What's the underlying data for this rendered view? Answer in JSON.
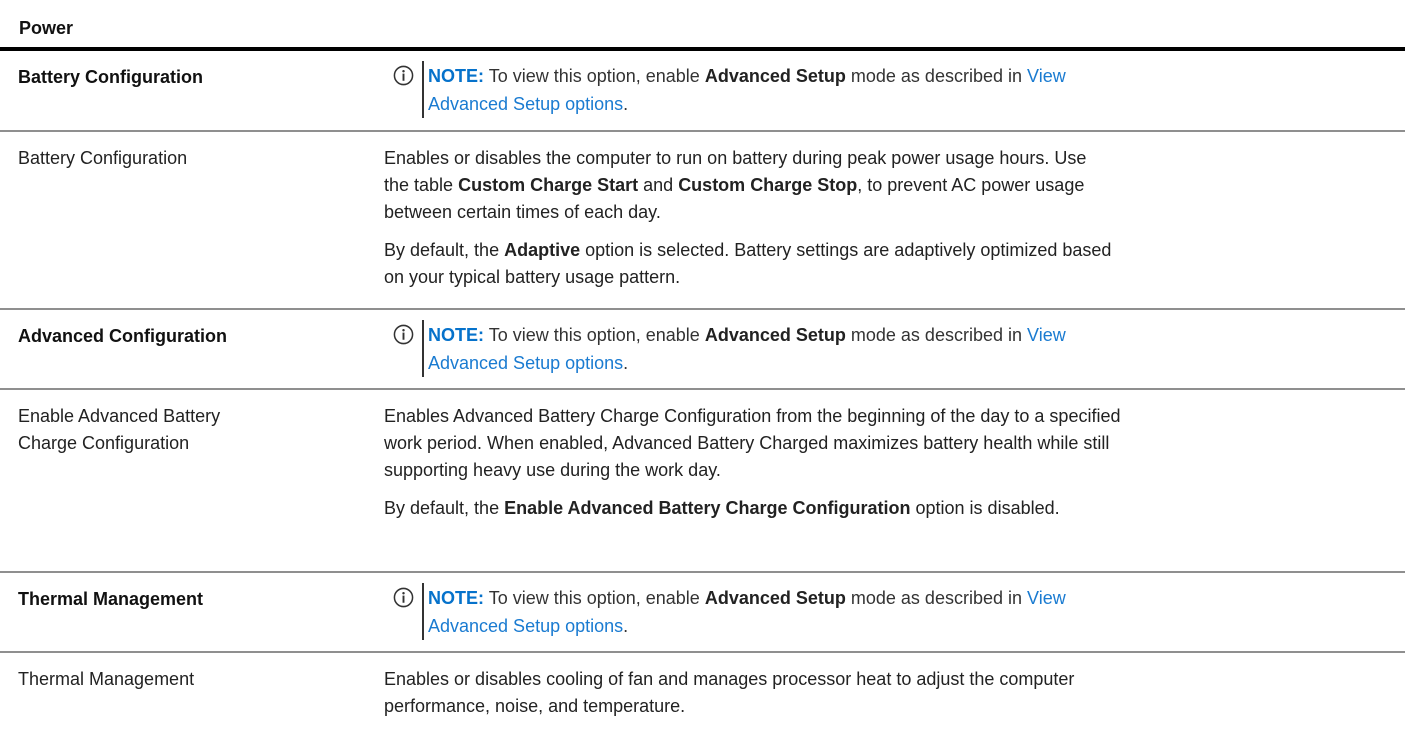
{
  "table_caption": "Power",
  "note": {
    "label": "NOTE:",
    "prefix": "To view this option, enable",
    "bold": "Advanced Setup",
    "middle": "mode as described in",
    "link_line1": "View",
    "link_line2": "Advanced Setup options",
    "suffix": "."
  },
  "rows": [
    {
      "label": "Battery Configuration",
      "type": "section"
    },
    {
      "label": "Battery Configuration",
      "p1": {
        "line1": "Enables or disables the computer to run on battery during peak power usage hours. Use",
        "pre": "the table",
        "b1": "Custom Charge Start",
        "and": "and",
        "b2": "Custom Charge Stop",
        "post": ", to prevent AC power usage",
        "line3": "between certain times of each day."
      },
      "p2": {
        "pre": "By default, the",
        "bold": "Adaptive",
        "post1": "option is selected. Battery settings are adaptively optimized based",
        "line2": "on your typical battery usage pattern."
      }
    },
    {
      "label": "Advanced Configuration",
      "type": "section"
    },
    {
      "label_line1": "Enable Advanced Battery",
      "label_line2": "Charge Configuration",
      "p1": {
        "line1": "Enables Advanced Battery Charge Configuration from the beginning of the day to a specified",
        "line2": "work period. When enabled, Advanced Battery Charged maximizes battery health while still",
        "line3": "supporting heavy use during the work day."
      },
      "p2": {
        "pre": "By default, the",
        "bold": "Enable Advanced Battery Charge Configuration",
        "post": "option is disabled."
      }
    },
    {
      "label": "Thermal Management",
      "type": "section"
    },
    {
      "label": "Thermal Management",
      "p1": {
        "line1": "Enables or disables cooling of fan and manages processor heat to adjust the computer",
        "line2": "performance, noise, and temperature."
      }
    }
  ],
  "colors": {
    "note_label": "#0672cb",
    "link": "#1a7bd1",
    "rule": "#000000",
    "separator": "#8f8f8f"
  },
  "icons": [
    "info-icon"
  ]
}
